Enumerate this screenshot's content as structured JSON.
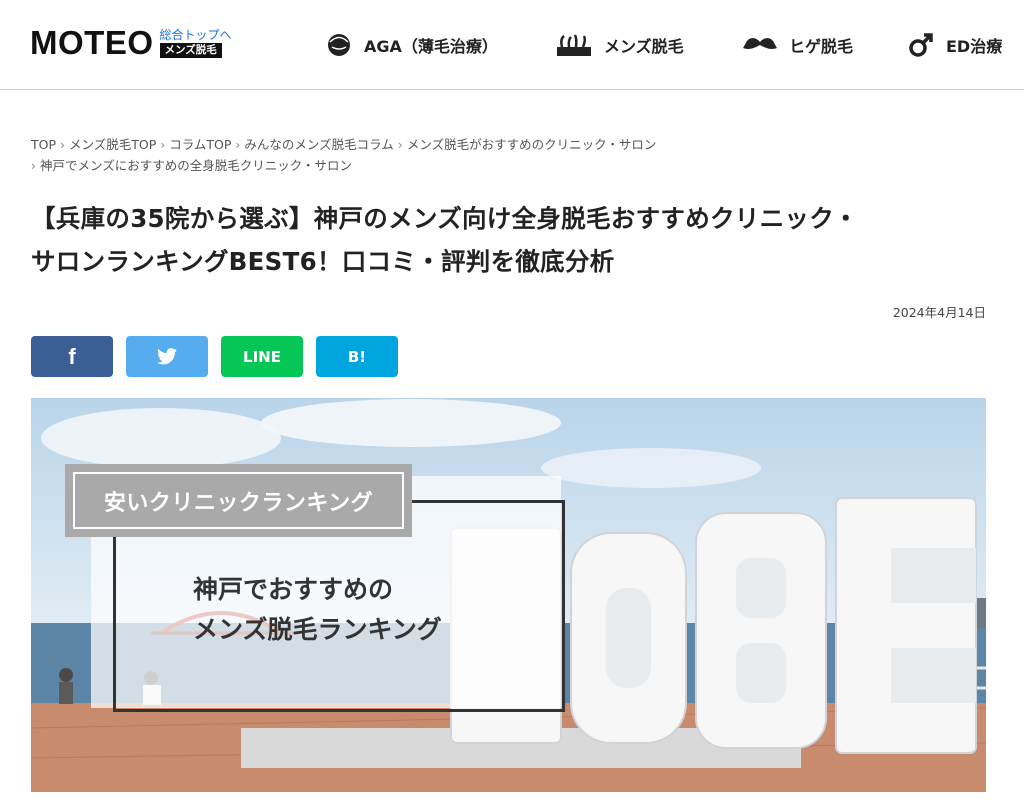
{
  "header": {
    "logo": {
      "text": "MOTEO",
      "top_link": "総合トップへ",
      "badge": "メンズ脱毛"
    },
    "nav": [
      {
        "label": "AGA（薄毛治療）",
        "icon": "head-icon"
      },
      {
        "label": "メンズ脱毛",
        "icon": "hair-icon"
      },
      {
        "label": "ヒゲ脱毛",
        "icon": "mustache-icon"
      },
      {
        "label": "ED治療",
        "icon": "male-symbol-icon"
      }
    ]
  },
  "breadcrumb": {
    "items": [
      "TOP",
      "メンズ脱毛TOP",
      "コラムTOP",
      "みんなのメンズ脱毛コラム",
      "メンズ脱毛がおすすめのクリニック・サロン"
    ],
    "current": "神戸でメンズにおすすめの全身脱毛クリニック・サロン",
    "separator": "›"
  },
  "article": {
    "title_line1": "【兵庫の35院から選ぶ】神戸のメンズ向け全身脱毛おすすめクリニック・",
    "title_line2": "サロンランキングBEST6！口コミ・評判を徹底分析",
    "date": "2024年4月14日"
  },
  "share": {
    "facebook": "f",
    "line": "LINE",
    "hatena": "B!"
  },
  "hero": {
    "badge": "安いクリニックランキング",
    "line1": "神戸でおすすめの",
    "line2": "メンズ脱毛ランキング",
    "sign_letters": "KOBE",
    "colors": {
      "sky": "#b9d4ea",
      "sea": "#5d86a6",
      "pavement": "#c98b6e"
    }
  }
}
